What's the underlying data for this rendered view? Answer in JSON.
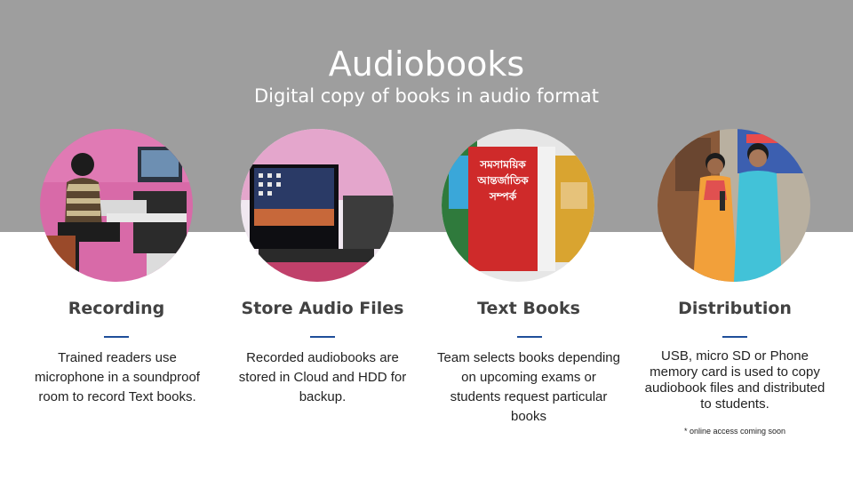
{
  "header": {
    "title": "Audiobooks",
    "subtitle": "Digital copy of books in audio format"
  },
  "colors": {
    "band": "#9e9e9e",
    "accent_rule": "#1f4e9a",
    "heading": "#424242"
  },
  "columns": [
    {
      "title": "Recording",
      "description": "Trained readers use microphone in a soundproof room to record Text books.",
      "image": "woman-recording-at-desk-photo"
    },
    {
      "title": "Store Audio Files",
      "description": "Recorded audiobooks are stored in Cloud and HDD for backup.",
      "image": "computer-monitor-photo"
    },
    {
      "title": "Text Books",
      "description": "Team selects books depending on upcoming exams or students request particular books",
      "image": "red-textbook-photo"
    },
    {
      "title": "Distribution",
      "description": "USB, micro SD or Phone memory card is used to copy audiobook files and distributed to students.",
      "note": "* online access coming soon",
      "image": "two-students-photo"
    }
  ],
  "photo_text": {
    "book_line1": "সমসাময়িক",
    "book_line2": "আন্তর্জাতিক",
    "book_line3": "সম্পর্ক"
  }
}
